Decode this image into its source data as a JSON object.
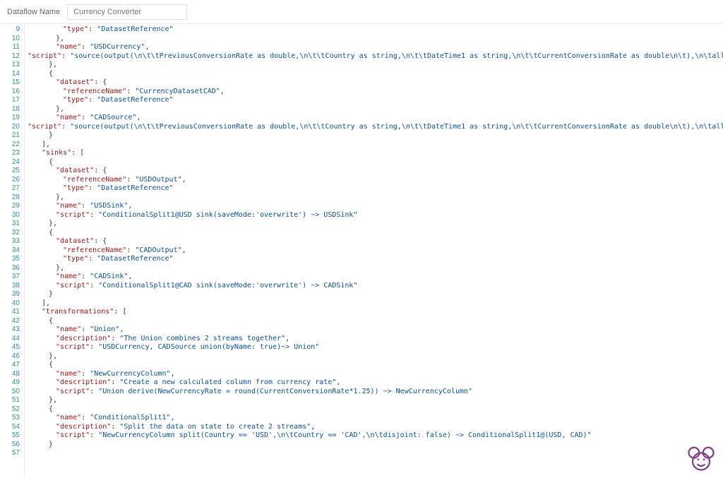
{
  "header": {
    "label": "Dataflow Name",
    "placeholder": "Currency Converter"
  },
  "startLine": 9,
  "lines": [
    {
      "indent": 5,
      "tokens": [
        [
          "key",
          "\"type\""
        ],
        [
          "colon",
          ": "
        ],
        [
          "str",
          "\"DatasetReference\""
        ]
      ]
    },
    {
      "indent": 4,
      "tokens": [
        [
          "brace",
          "},"
        ]
      ]
    },
    {
      "indent": 4,
      "tokens": [
        [
          "key",
          "\"name\""
        ],
        [
          "colon",
          ": "
        ],
        [
          "str",
          "\"USDCurrency\""
        ],
        [
          "comma",
          ","
        ]
      ]
    },
    {
      "indent": 4,
      "tokens": [
        [
          "key",
          "\"script\""
        ],
        [
          "colon",
          ": "
        ],
        [
          "str",
          "\"source(output(\\n\\t\\tPreviousConversionRate as double,\\n\\t\\tCountry as string,\\n\\t\\tDateTime1 as string,\\n\\t\\tCurrentConversionRate as double\\n\\t),\\n\\tallowSchemaDrift: false,\\n\\tvalidateSchema: false) ~> USDCurrency\""
        ]
      ]
    },
    {
      "indent": 3,
      "tokens": [
        [
          "brace",
          "},"
        ]
      ]
    },
    {
      "indent": 3,
      "tokens": [
        [
          "brace",
          "{"
        ]
      ]
    },
    {
      "indent": 4,
      "tokens": [
        [
          "key",
          "\"dataset\""
        ],
        [
          "colon",
          ": "
        ],
        [
          "brace",
          "{"
        ]
      ]
    },
    {
      "indent": 5,
      "tokens": [
        [
          "key",
          "\"referenceName\""
        ],
        [
          "colon",
          ": "
        ],
        [
          "str",
          "\"CurrencyDatasetCAD\""
        ],
        [
          "comma",
          ","
        ]
      ]
    },
    {
      "indent": 5,
      "tokens": [
        [
          "key",
          "\"type\""
        ],
        [
          "colon",
          ": "
        ],
        [
          "str",
          "\"DatasetReference\""
        ]
      ]
    },
    {
      "indent": 4,
      "tokens": [
        [
          "brace",
          "},"
        ]
      ]
    },
    {
      "indent": 4,
      "tokens": [
        [
          "key",
          "\"name\""
        ],
        [
          "colon",
          ": "
        ],
        [
          "str",
          "\"CADSource\""
        ],
        [
          "comma",
          ","
        ]
      ]
    },
    {
      "indent": 4,
      "tokens": [
        [
          "key",
          "\"script\""
        ],
        [
          "colon",
          ": "
        ],
        [
          "str",
          "\"source(output(\\n\\t\\tPreviousConversionRate as double,\\n\\t\\tCountry as string,\\n\\t\\tDateTime1 as string,\\n\\t\\tCurrentConversionRate as double\\n\\t),\\n\\tallowSchemaDrift: true,\\n\\tvalidateSchema: false) ~> CADSource\""
        ]
      ]
    },
    {
      "indent": 3,
      "tokens": [
        [
          "brace",
          "}"
        ]
      ]
    },
    {
      "indent": 2,
      "tokens": [
        [
          "bracket",
          "],"
        ]
      ]
    },
    {
      "indent": 2,
      "tokens": [
        [
          "key",
          "\"sinks\""
        ],
        [
          "colon",
          ": "
        ],
        [
          "bracket",
          "["
        ]
      ]
    },
    {
      "indent": 3,
      "tokens": [
        [
          "brace",
          "{"
        ]
      ]
    },
    {
      "indent": 4,
      "tokens": [
        [
          "key",
          "\"dataset\""
        ],
        [
          "colon",
          ": "
        ],
        [
          "brace",
          "{"
        ]
      ]
    },
    {
      "indent": 5,
      "tokens": [
        [
          "key",
          "\"referenceName\""
        ],
        [
          "colon",
          ": "
        ],
        [
          "str",
          "\"USDOutput\""
        ],
        [
          "comma",
          ","
        ]
      ]
    },
    {
      "indent": 5,
      "tokens": [
        [
          "key",
          "\"type\""
        ],
        [
          "colon",
          ": "
        ],
        [
          "str",
          "\"DatasetReference\""
        ]
      ]
    },
    {
      "indent": 4,
      "tokens": [
        [
          "brace",
          "},"
        ]
      ]
    },
    {
      "indent": 4,
      "tokens": [
        [
          "key",
          "\"name\""
        ],
        [
          "colon",
          ": "
        ],
        [
          "str",
          "\"USDSink\""
        ],
        [
          "comma",
          ","
        ]
      ]
    },
    {
      "indent": 4,
      "tokens": [
        [
          "key",
          "\"script\""
        ],
        [
          "colon",
          ": "
        ],
        [
          "str",
          "\"ConditionalSplit1@USD sink(saveMode:'overwrite') ~> USDSink\""
        ]
      ]
    },
    {
      "indent": 3,
      "tokens": [
        [
          "brace",
          "},"
        ]
      ]
    },
    {
      "indent": 3,
      "tokens": [
        [
          "brace",
          "{"
        ]
      ]
    },
    {
      "indent": 4,
      "tokens": [
        [
          "key",
          "\"dataset\""
        ],
        [
          "colon",
          ": "
        ],
        [
          "brace",
          "{"
        ]
      ]
    },
    {
      "indent": 5,
      "tokens": [
        [
          "key",
          "\"referenceName\""
        ],
        [
          "colon",
          ": "
        ],
        [
          "str",
          "\"CADOutput\""
        ],
        [
          "comma",
          ","
        ]
      ]
    },
    {
      "indent": 5,
      "tokens": [
        [
          "key",
          "\"type\""
        ],
        [
          "colon",
          ": "
        ],
        [
          "str",
          "\"DatasetReference\""
        ]
      ]
    },
    {
      "indent": 4,
      "tokens": [
        [
          "brace",
          "},"
        ]
      ]
    },
    {
      "indent": 4,
      "tokens": [
        [
          "key",
          "\"name\""
        ],
        [
          "colon",
          ": "
        ],
        [
          "str",
          "\"CADSink\""
        ],
        [
          "comma",
          ","
        ]
      ]
    },
    {
      "indent": 4,
      "tokens": [
        [
          "key",
          "\"script\""
        ],
        [
          "colon",
          ": "
        ],
        [
          "str",
          "\"ConditionalSplit1@CAD sink(saveMode:'overwrite') ~> CADSink\""
        ]
      ]
    },
    {
      "indent": 3,
      "tokens": [
        [
          "brace",
          "}"
        ]
      ]
    },
    {
      "indent": 2,
      "tokens": [
        [
          "bracket",
          "],"
        ]
      ]
    },
    {
      "indent": 2,
      "tokens": [
        [
          "key",
          "\"transformations\""
        ],
        [
          "colon",
          ": "
        ],
        [
          "bracket",
          "["
        ]
      ]
    },
    {
      "indent": 3,
      "tokens": [
        [
          "brace",
          "{"
        ]
      ]
    },
    {
      "indent": 4,
      "tokens": [
        [
          "key",
          "\"name\""
        ],
        [
          "colon",
          ": "
        ],
        [
          "str",
          "\"Union\""
        ],
        [
          "comma",
          ","
        ]
      ]
    },
    {
      "indent": 4,
      "tokens": [
        [
          "key",
          "\"description\""
        ],
        [
          "colon",
          ": "
        ],
        [
          "str",
          "\"The Union combines 2 streams together\""
        ],
        [
          "comma",
          ","
        ]
      ]
    },
    {
      "indent": 4,
      "tokens": [
        [
          "key",
          "\"script\""
        ],
        [
          "colon",
          ": "
        ],
        [
          "str",
          "\"USDCurrency, CADSource union(byName: true)~> Union\""
        ]
      ]
    },
    {
      "indent": 3,
      "tokens": [
        [
          "brace",
          "},"
        ]
      ]
    },
    {
      "indent": 3,
      "tokens": [
        [
          "brace",
          "{"
        ]
      ]
    },
    {
      "indent": 4,
      "tokens": [
        [
          "key",
          "\"name\""
        ],
        [
          "colon",
          ": "
        ],
        [
          "str",
          "\"NewCurrencyColumn\""
        ],
        [
          "comma",
          ","
        ]
      ]
    },
    {
      "indent": 4,
      "tokens": [
        [
          "key",
          "\"description\""
        ],
        [
          "colon",
          ": "
        ],
        [
          "str",
          "\"Create a new calculated column from currency rate\""
        ],
        [
          "comma",
          ","
        ]
      ]
    },
    {
      "indent": 4,
      "tokens": [
        [
          "key",
          "\"script\""
        ],
        [
          "colon",
          ": "
        ],
        [
          "str",
          "\"Union derive(NewCurrencyRate = round(CurrentConversionRate*1.25)) ~> NewCurrencyColumn\""
        ]
      ]
    },
    {
      "indent": 3,
      "tokens": [
        [
          "brace",
          "},"
        ]
      ]
    },
    {
      "indent": 3,
      "tokens": [
        [
          "brace",
          "{"
        ]
      ]
    },
    {
      "indent": 4,
      "tokens": [
        [
          "key",
          "\"name\""
        ],
        [
          "colon",
          ": "
        ],
        [
          "str",
          "\"ConditionalSplit1\""
        ],
        [
          "comma",
          ","
        ]
      ]
    },
    {
      "indent": 4,
      "tokens": [
        [
          "key",
          "\"description\""
        ],
        [
          "colon",
          ": "
        ],
        [
          "str",
          "\"Split the data on state to create 2 streams\""
        ],
        [
          "comma",
          ","
        ]
      ]
    },
    {
      "indent": 4,
      "tokens": [
        [
          "key",
          "\"script\""
        ],
        [
          "colon",
          ": "
        ],
        [
          "str",
          "\"NewCurrencyColumn split(Country == 'USD',\\n\\tCountry == 'CAD',\\n\\tdisjoint: false) ~> ConditionalSplit1@(USD, CAD)\""
        ]
      ]
    },
    {
      "indent": 3,
      "tokens": [
        [
          "brace",
          "}"
        ]
      ]
    },
    {
      "indent": 0,
      "tokens": []
    }
  ]
}
